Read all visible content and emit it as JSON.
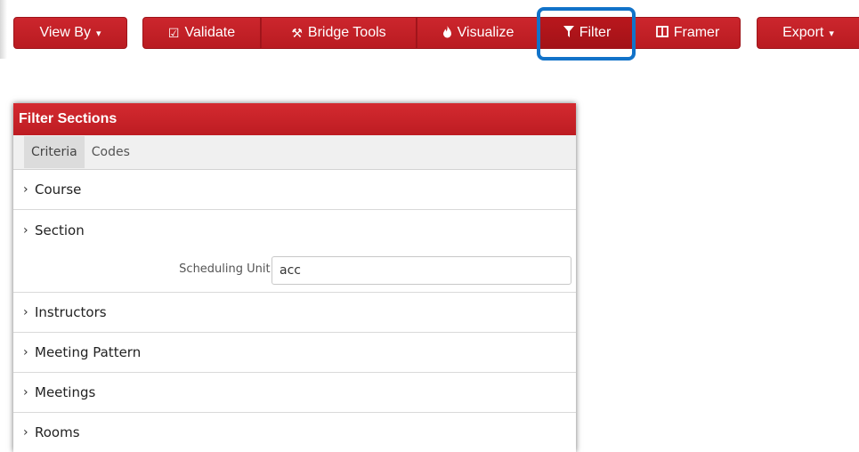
{
  "toolbar": {
    "view_by": {
      "label": "View By",
      "caret": "▾"
    },
    "validate": {
      "label": "Validate",
      "icon": "check-square-icon",
      "glyph": "☑"
    },
    "bridge_tools": {
      "label": "Bridge Tools",
      "icon": "tools-icon",
      "glyph": "⚒"
    },
    "visualize": {
      "label": "Visualize",
      "icon": "fire-icon",
      "glyph": "🔥"
    },
    "filter": {
      "label": "Filter",
      "icon": "filter-icon",
      "glyph": "▼"
    },
    "framer": {
      "label": "Framer",
      "icon": "columns-icon",
      "glyph": "◫"
    },
    "export": {
      "label": "Export",
      "caret": "▾"
    },
    "accent_color": "#c21f26",
    "highlight_color": "#1273c9"
  },
  "panel": {
    "title": "Filter Sections",
    "tabs": [
      {
        "label": "Criteria",
        "active": true
      },
      {
        "label": "Codes",
        "active": false
      }
    ],
    "chevron": "›",
    "sections": {
      "course": "Course",
      "section": "Section",
      "instructors": "Instructors",
      "meeting_pattern": "Meeting Pattern",
      "meetings": "Meetings",
      "rooms": "Rooms"
    },
    "scheduling_unit": {
      "label": "Scheduling Unit:",
      "value": "acc"
    }
  }
}
